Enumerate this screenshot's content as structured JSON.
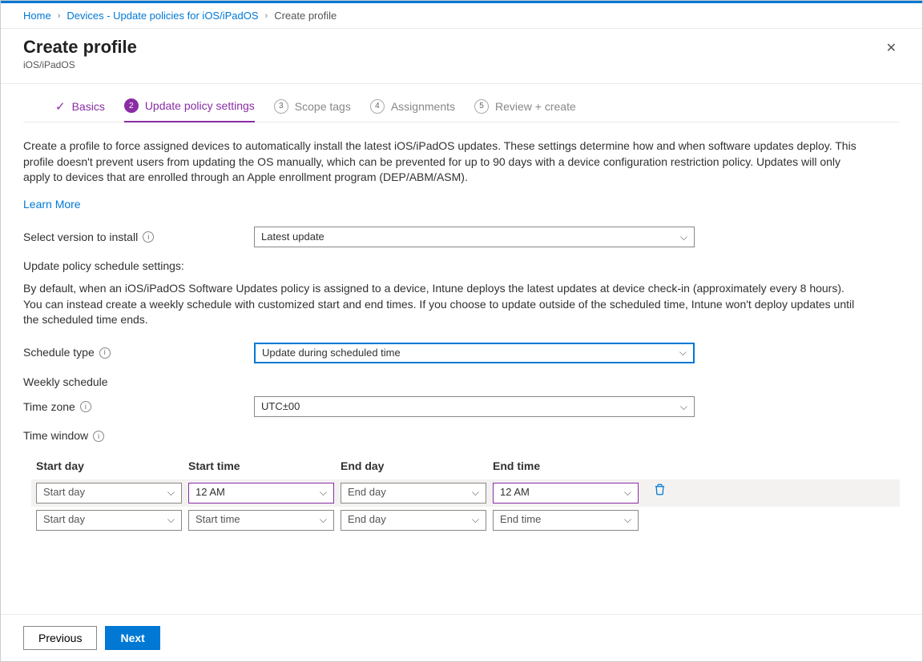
{
  "breadcrumb": {
    "home": "Home",
    "devices": "Devices - Update policies for iOS/iPadOS",
    "current": "Create profile"
  },
  "header": {
    "title": "Create profile",
    "subtitle": "iOS/iPadOS"
  },
  "steps": {
    "s1": "Basics",
    "s2_num": "2",
    "s2": "Update policy settings",
    "s3_num": "3",
    "s3": "Scope tags",
    "s4_num": "4",
    "s4": "Assignments",
    "s5_num": "5",
    "s5": "Review + create"
  },
  "body": {
    "intro": "Create a profile to force assigned devices to automatically install the latest iOS/iPadOS updates. These settings determine how and when software updates deploy. This profile doesn't prevent users from updating the OS manually, which can be prevented for up to 90 days with a device configuration restriction policy. Updates will only apply to devices that are enrolled through an Apple enrollment program (DEP/ABM/ASM).",
    "learn_more": "Learn More",
    "version_label": "Select version to install",
    "version_value": "Latest update",
    "schedule_settings_title": "Update policy schedule settings:",
    "schedule_desc": "By default, when an iOS/iPadOS Software Updates policy is assigned to a device, Intune deploys the latest updates at device check-in (approximately every 8 hours). You can instead create a weekly schedule with customized start and end times. If you choose to update outside of the scheduled time, Intune won't deploy updates until the scheduled time ends.",
    "schedule_type_label": "Schedule type",
    "schedule_type_value": "Update during scheduled time",
    "weekly_schedule": "Weekly schedule",
    "timezone_label": "Time zone",
    "timezone_value": "UTC±00",
    "time_window_label": "Time window"
  },
  "table": {
    "headers": {
      "c1": "Start day",
      "c2": "Start time",
      "c3": "End day",
      "c4": "End time"
    },
    "row1": {
      "c1": "Start day",
      "c2": "12 AM",
      "c3": "End day",
      "c4": "12 AM"
    },
    "row2": {
      "c1": "Start day",
      "c2": "Start time",
      "c3": "End day",
      "c4": "End time"
    }
  },
  "footer": {
    "previous": "Previous",
    "next": "Next"
  }
}
